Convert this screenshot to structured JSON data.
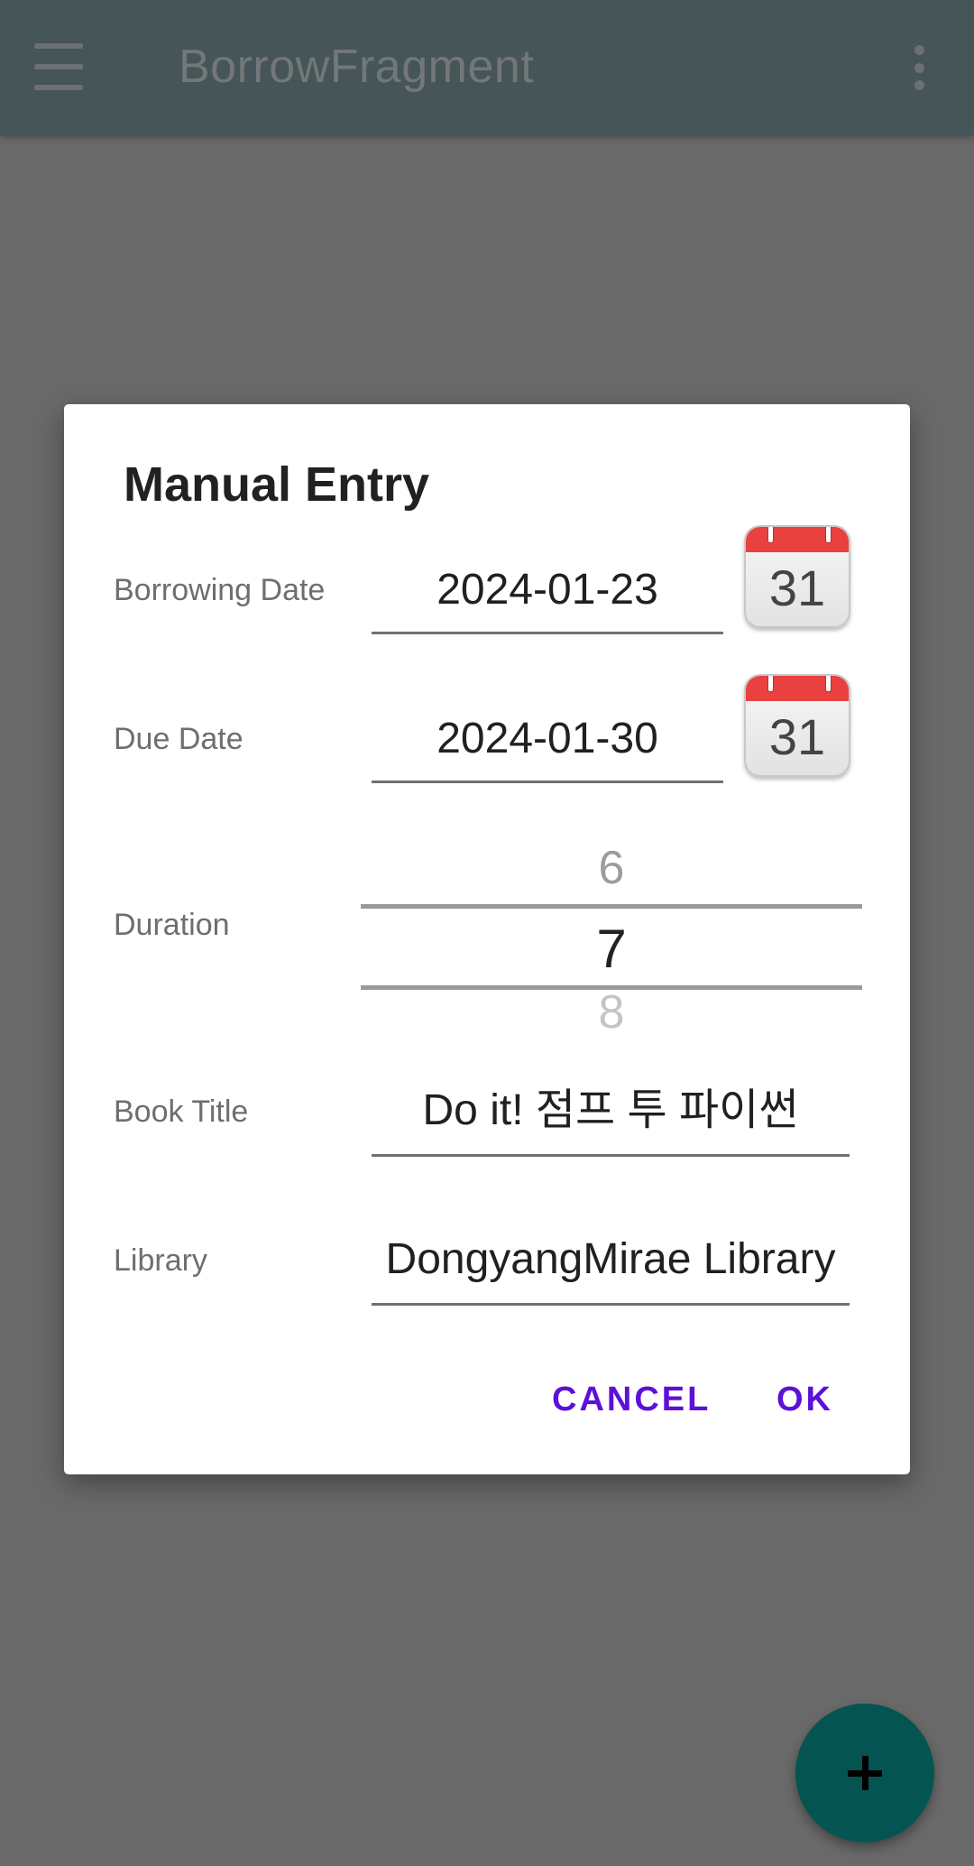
{
  "appbar": {
    "title": "BorrowFragment",
    "menu_icon": "hamburger-menu-icon",
    "overflow_icon": "more-vert-icon"
  },
  "dialog": {
    "title": "Manual Entry",
    "borrowing_date": {
      "label": "Borrowing Date",
      "value": "2024-01-23",
      "calendar_day": "31"
    },
    "due_date": {
      "label": "Due Date",
      "value": "2024-01-30",
      "calendar_day": "31"
    },
    "duration": {
      "label": "Duration",
      "prev": "6",
      "current": "7",
      "next": "8"
    },
    "book_title": {
      "label": "Book Title",
      "value": "Do it! 점프 투 파이썬"
    },
    "library": {
      "label": "Library",
      "value": "DongyangMirae Library"
    },
    "cancel_label": "CANCEL",
    "ok_label": "OK"
  },
  "fab": {
    "icon": "add-icon"
  },
  "colors": {
    "appbar": "#455558",
    "scrim": "#696969",
    "accent": "#5c10d8",
    "fab": "#045551",
    "calendar_red": "#e94040"
  }
}
